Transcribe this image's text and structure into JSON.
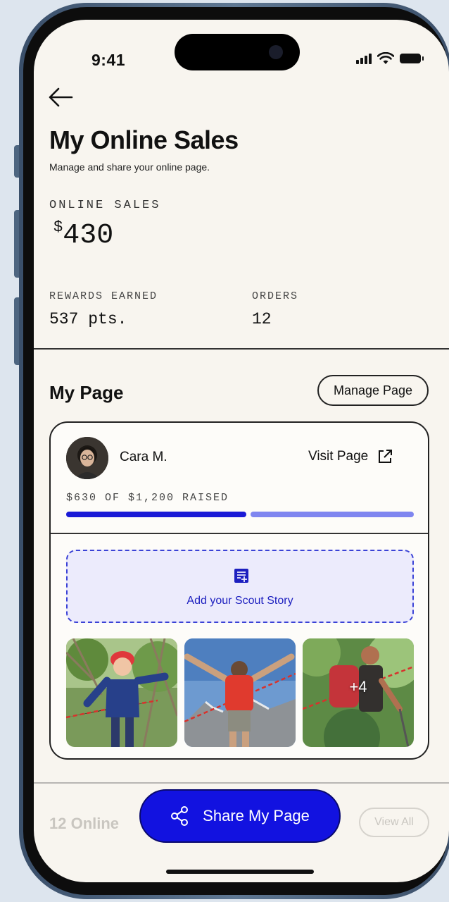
{
  "status_bar": {
    "time": "9:41"
  },
  "header": {
    "title": "My Online Sales",
    "subtitle": "Manage and share your online page."
  },
  "stats": {
    "online_sales_label": "ONLINE SALES",
    "online_sales_currency": "$",
    "online_sales_value": "430",
    "rewards_label": "REWARDS EARNED",
    "rewards_value": "537 pts.",
    "orders_label": "ORDERS",
    "orders_value": "12"
  },
  "my_page": {
    "section_title": "My Page",
    "manage_button": "Manage Page",
    "card": {
      "name": "Cara M.",
      "visit_link": "Visit Page",
      "raised_text": "$630 OF $1,200 RAISED",
      "progress_fraction": 0.525,
      "story_label": "Add your Scout Story",
      "extra_photos_badge": "+4"
    }
  },
  "online_orders": {
    "section_title_partial": "12 Online",
    "view_all_button": "View All"
  },
  "share_button": "Share My Page",
  "colors": {
    "accent": "#1212e0",
    "progress_fill": "#1a1ad6",
    "progress_rest": "#7f86f0",
    "story_bg": "#ecebfc",
    "story_text": "#1c1fbf",
    "background": "#f8f5ef"
  },
  "icons": {
    "back": "arrow-left-icon",
    "external": "external-link-icon",
    "story": "add-note-icon",
    "share": "share-nodes-icon"
  }
}
